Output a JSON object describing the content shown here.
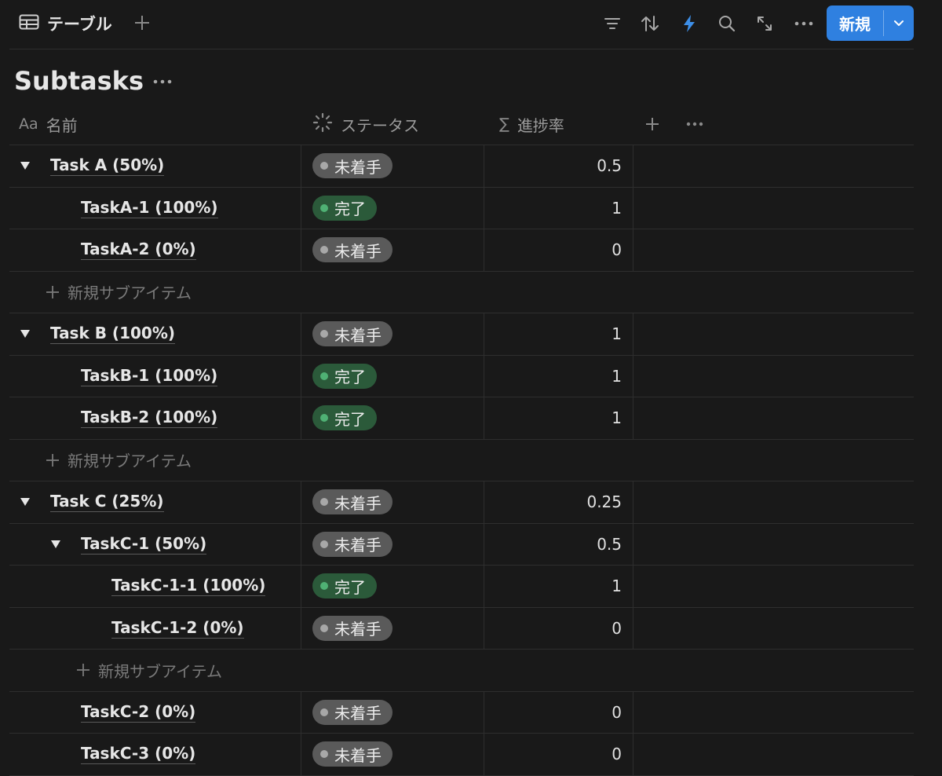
{
  "toolbar": {
    "view_tab_label": "テーブル",
    "new_button_label": "新規",
    "accent_color": "#2f80e0"
  },
  "database": {
    "title": "Subtasks"
  },
  "columns": [
    {
      "icon": "text-property-icon",
      "glyph": "Aa",
      "label": "名前"
    },
    {
      "icon": "status-property-icon",
      "label": "ステータス"
    },
    {
      "icon": "formula-property-icon",
      "glyph": "∑",
      "label": "進捗率"
    }
  ],
  "status_options": {
    "todo": {
      "label": "未着手",
      "color": "#5a5a5a"
    },
    "done": {
      "label": "完了",
      "color": "#2b5a3a"
    }
  },
  "add_subitem_label": "新規サブアイテム",
  "rows": [
    {
      "type": "item",
      "level": 0,
      "expanded": true,
      "name": "Task A (50%)",
      "status": "todo",
      "status_label": "未着手",
      "progress": "0.5"
    },
    {
      "type": "item",
      "level": 1,
      "expanded": null,
      "name": "TaskA-1 (100%)",
      "status": "done",
      "status_label": "完了",
      "progress": "1"
    },
    {
      "type": "item",
      "level": 1,
      "expanded": null,
      "name": "TaskA-2 (0%)",
      "status": "todo",
      "status_label": "未着手",
      "progress": "0"
    },
    {
      "type": "add",
      "level": 0
    },
    {
      "type": "item",
      "level": 0,
      "expanded": true,
      "name": "Task B (100%)",
      "status": "todo",
      "status_label": "未着手",
      "progress": "1"
    },
    {
      "type": "item",
      "level": 1,
      "expanded": null,
      "name": "TaskB-1 (100%)",
      "status": "done",
      "status_label": "完了",
      "progress": "1"
    },
    {
      "type": "item",
      "level": 1,
      "expanded": null,
      "name": "TaskB-2 (100%)",
      "status": "done",
      "status_label": "完了",
      "progress": "1"
    },
    {
      "type": "add",
      "level": 0
    },
    {
      "type": "item",
      "level": 0,
      "expanded": true,
      "name": "Task C (25%)",
      "status": "todo",
      "status_label": "未着手",
      "progress": "0.25"
    },
    {
      "type": "item",
      "level": 1,
      "expanded": true,
      "name": "TaskC-1 (50%)",
      "status": "todo",
      "status_label": "未着手",
      "progress": "0.5"
    },
    {
      "type": "item",
      "level": 2,
      "expanded": null,
      "name": "TaskC-1-1 (100%)",
      "status": "done",
      "status_label": "完了",
      "progress": "1"
    },
    {
      "type": "item",
      "level": 2,
      "expanded": null,
      "name": "TaskC-1-2 (0%)",
      "status": "todo",
      "status_label": "未着手",
      "progress": "0"
    },
    {
      "type": "add",
      "level": 1
    },
    {
      "type": "item",
      "level": 1,
      "expanded": null,
      "name": "TaskC-2 (0%)",
      "status": "todo",
      "status_label": "未着手",
      "progress": "0"
    },
    {
      "type": "item",
      "level": 1,
      "expanded": null,
      "name": "TaskC-3 (0%)",
      "status": "todo",
      "status_label": "未着手",
      "progress": "0"
    }
  ]
}
